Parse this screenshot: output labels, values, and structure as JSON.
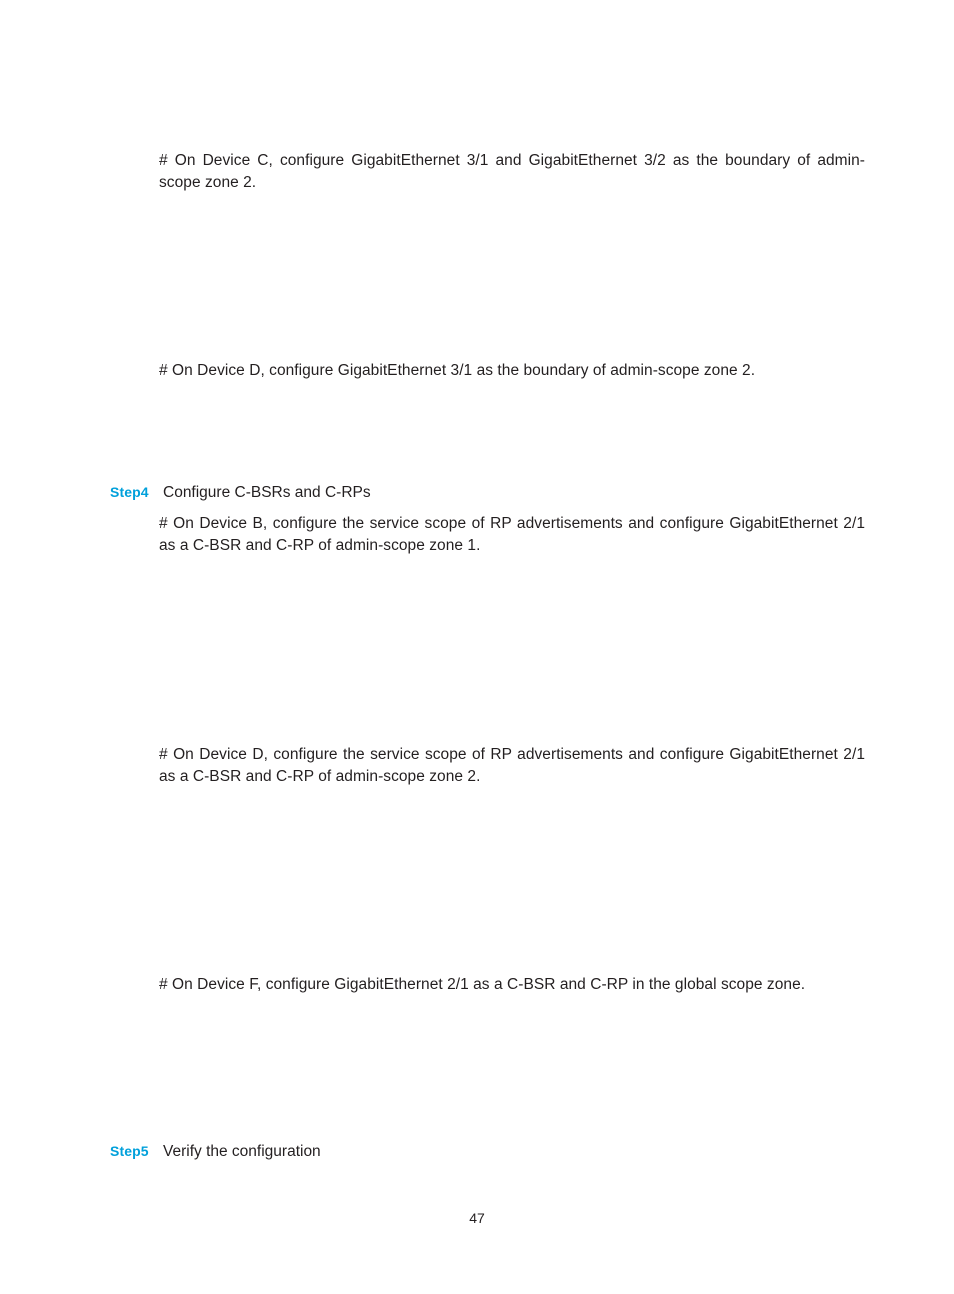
{
  "document": {
    "page_number": "47",
    "accent_color": "#00a0db",
    "text_color": "#231f20",
    "background_color": "#ffffff"
  },
  "content": {
    "paragraphs": [
      {
        "id": "device-c-boundary",
        "text": "# On Device C, configure GigabitEthernet 3/1 and GigabitEthernet 3/2 as the boundary of admin-scope zone 2."
      },
      {
        "id": "device-d-boundary",
        "text": "# On Device D, configure GigabitEthernet 3/1 as the boundary of admin-scope zone 2."
      },
      {
        "id": "device-b-cbsr-crp",
        "text": "# On Device B, configure the service scope of RP advertisements and configure GigabitEthernet 2/1 as a C-BSR and C-RP of admin-scope zone 1."
      },
      {
        "id": "device-d-cbsr-crp",
        "text": "# On Device D, configure the service scope of RP advertisements and configure GigabitEthernet 2/1 as a C-BSR and C-RP of admin-scope zone 2."
      },
      {
        "id": "device-f-cbsr-crp",
        "text": "#  On Device F, configure GigabitEthernet 2/1 as a C-BSR and C-RP in the global scope zone."
      }
    ],
    "steps": [
      {
        "id": "step-4",
        "label": "Step4",
        "text": "Configure C-BSRs and C-RPs"
      },
      {
        "id": "step-5",
        "label": "Step5",
        "text": "Verify the configuration"
      }
    ]
  }
}
